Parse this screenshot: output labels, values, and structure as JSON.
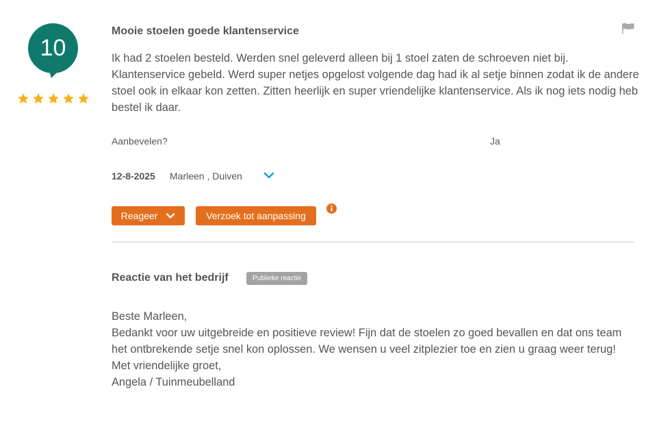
{
  "review": {
    "score": "10",
    "rating_stars": 5,
    "title": "Mooie stoelen goede klantenservice",
    "body": "Ik had 2 stoelen besteld. Werden snel geleverd alleen bij 1 stoel zaten de schroeven niet bij. Klantenservice gebeld. Werd super netjes opgelost volgende dag had ik al setje binnen zodat ik de andere stoel ook in elkaar kon zetten. Zitten heerlijk en super vriendelijke klantenservice. Als ik nog iets nodig heb bestel ik daar.",
    "recommend_label": "Aanbevelen?",
    "recommend_value": "Ja",
    "date": "12-8-2025",
    "author": "Marleen , Duiven"
  },
  "actions": {
    "reply_label": "Reageer",
    "request_label": "Verzoek tot aanpassing"
  },
  "response": {
    "title": "Reactie van het bedrijf",
    "badge": "Publieke reactie",
    "lines": [
      "Beste Marleen,",
      "Bedankt voor uw uitgebreide en positieve review! Fijn dat de stoelen zo goed bevallen en dat ons team het ontbrekende setje snel kon oplossen. We wensen u veel zitplezier toe en zien u graag weer terug!",
      "Met vriendelijke groet,",
      "Angela / Tuinmeubelland"
    ]
  },
  "colors": {
    "score_badge": "#0f7a6c",
    "star": "#f6b01e",
    "accent_button": "#e36f1e",
    "chevron": "#1aa3d9",
    "text": "#555555",
    "badge_gray": "#a3a3a3"
  },
  "icons": {
    "flag": "flag-icon",
    "info": "info-icon",
    "chevron": "chevron-down-icon",
    "star": "star-icon"
  }
}
